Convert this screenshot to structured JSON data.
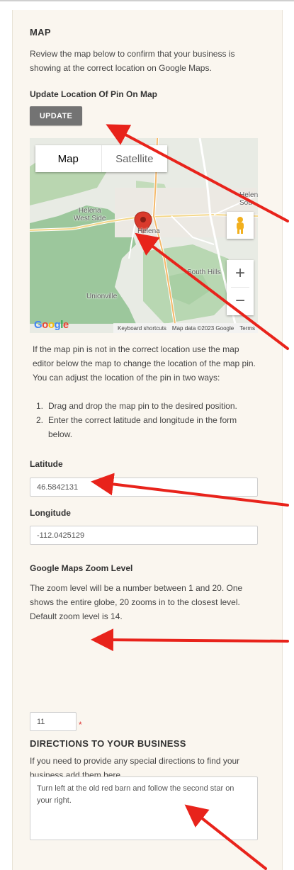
{
  "map_section": {
    "heading": "MAP",
    "intro": "Review the map below to confirm that your business is showing at the correct location on Google Maps.",
    "update_label": "Update Location Of Pin On Map",
    "update_button": "UPDATE"
  },
  "map": {
    "type_tabs": [
      "Map",
      "Satellite"
    ],
    "place_labels": [
      "Helena",
      "Helena West Side",
      "Helena",
      "South Hills",
      "Unionville",
      "Helen Sou"
    ],
    "route_shields": [
      "12",
      "15",
      "287",
      "15"
    ],
    "logo": "Google",
    "keyboard_shortcuts": "Keyboard shortcuts",
    "map_data": "Map data ©2023 Google",
    "terms": "Terms",
    "zoom_in": "+",
    "zoom_out": "−"
  },
  "help": {
    "paragraph": "If the map pin is not in the correct location use the map editor below the map to change the location of the map pin. You can adjust the location of the pin in two ways:",
    "steps": [
      "Drag and drop the map pin to the desired position.",
      "Enter the correct latitude and longitude in the form below."
    ]
  },
  "latitude": {
    "label": "Latitude",
    "value": "46.5842131"
  },
  "longitude": {
    "label": "Longitude",
    "value": "-112.0425129"
  },
  "zoom": {
    "label": "Google Maps Zoom Level",
    "description": "The zoom level will be a number between 1 and 20. One shows the entire globe, 20 zooms in to the closest level. Default zoom level is 14.",
    "value": "11",
    "required_mark": "*"
  },
  "directions": {
    "heading": "DIRECTIONS TO YOUR BUSINESS",
    "description": "If you need to provide any special directions to find your business add them here.",
    "value": "Turn left at the old red barn and follow the second star on your right."
  },
  "colors": {
    "panel_bg": "#faf6ef",
    "button_bg": "#737373",
    "arrow": "#e8231b",
    "pin": "#d93a2c"
  }
}
